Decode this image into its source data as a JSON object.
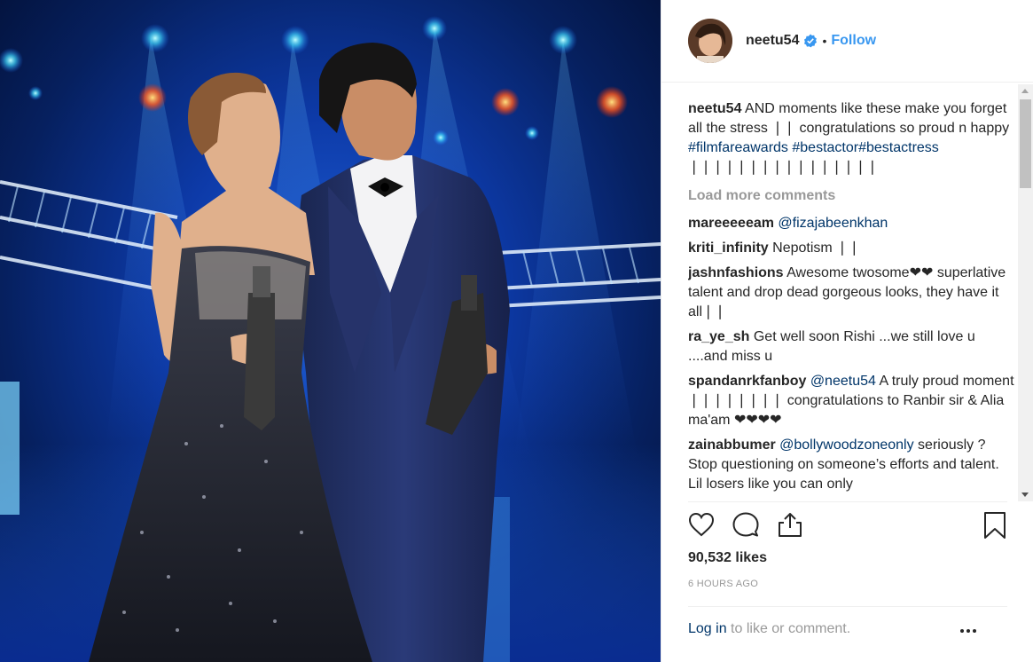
{
  "header": {
    "username": "neetu54",
    "separator": "•",
    "follow_label": "Follow"
  },
  "caption": {
    "username": "neetu54",
    "text": "AND moments like these make you forget all the stress ❘❘ congratulations so proud n happy ",
    "hashtags": "#filmfareawards #bestactor#bestactress",
    "tail": " ❘❘❘❘❘❘❘❘❘❘❘❘❘❘❘❘"
  },
  "load_more_label": "Load more comments",
  "comments": [
    {
      "username": "mareeeeeam",
      "mention": "@fizajabeenkhan",
      "text": ""
    },
    {
      "username": "kriti_infinity",
      "mention": "",
      "text": "Nepotism ❘❘"
    },
    {
      "username": "jashnfashions",
      "mention": "",
      "text": "Awesome twosome❤❤ superlative talent and drop dead gorgeous looks, they have it all❘❘"
    },
    {
      "username": "ra_ye_sh",
      "mention": "",
      "text": "Get well soon Rishi ...we still love u ....and miss u"
    },
    {
      "username": "spandanrkfanboy",
      "mention": "@neetu54",
      "text": "A truly proud moment ❘❘❘❘❘❘❘❘ congratulations to Ranbir sir & Alia ma'am ❤❤❤❤"
    },
    {
      "username": "zainabbumer",
      "mention": "@bollywoodzoneonly",
      "text": "seriously ? Stop questioning on someone’s efforts and talent. Lil losers like you can only"
    }
  ],
  "likes": "90,532 likes",
  "timestamp": "6 HOURS AGO",
  "login": {
    "link_label": "Log in",
    "suffix": " to like or comment."
  },
  "icons": {
    "like": "heart-icon",
    "comment": "comment-bubble-icon",
    "share": "share-icon",
    "save": "bookmark-icon",
    "more": "more-options-icon",
    "verified": "verified-badge-icon"
  },
  "colors": {
    "link": "#3897f0",
    "hashtag": "#003569",
    "muted": "#999999",
    "text": "#262626"
  }
}
